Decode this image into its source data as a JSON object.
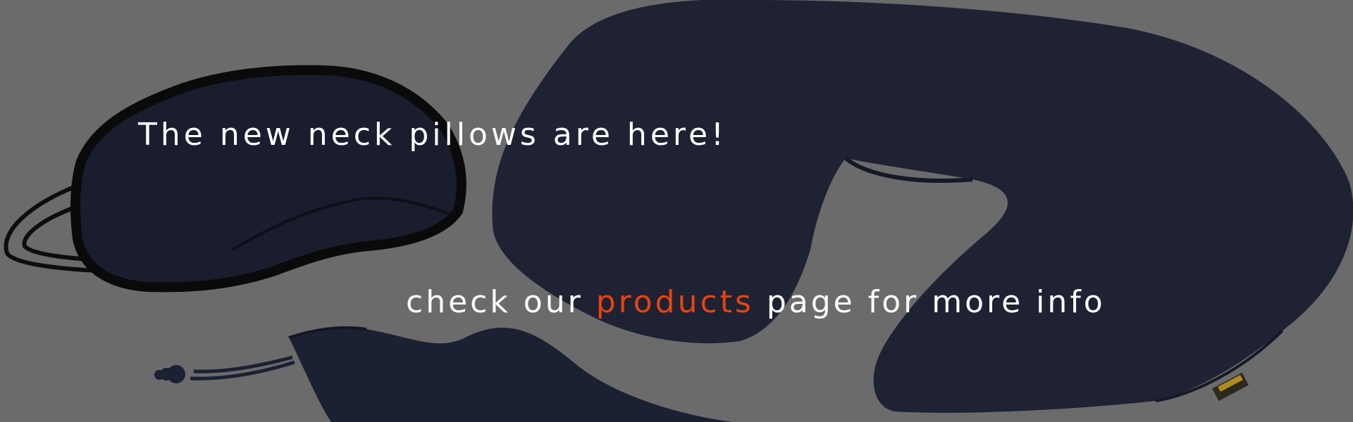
{
  "banner": {
    "headline": "The new neck pillows are here!",
    "cta": {
      "before": "check our",
      "link": "products",
      "after": "page for more info"
    }
  },
  "colors": {
    "background": "#6b6b6b",
    "fabric": "#1e2233",
    "text": "#ffffff",
    "link": "#e8430f"
  },
  "icons": {
    "mask": "sleep-mask-icon",
    "pillow": "neck-pillow-icon",
    "pouch": "drawstring-pouch-icon"
  }
}
